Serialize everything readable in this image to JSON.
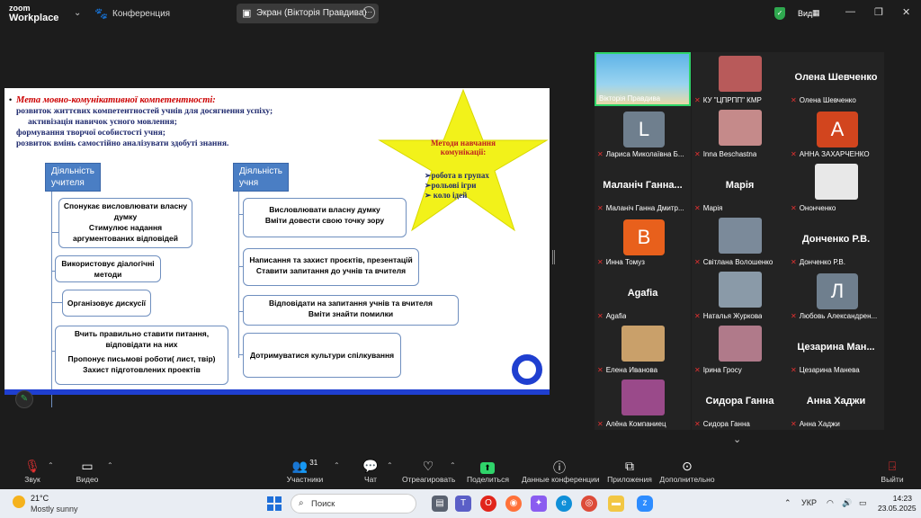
{
  "topbar": {
    "logo_line1": "zoom",
    "logo_line2": "Workplace",
    "conference_label": "Конференция",
    "share_label": "Экран (Вікторія Правдива)",
    "view_label": "Вид"
  },
  "slide": {
    "title": "Мета мовно-комунікативної компетентності:",
    "lines": [
      "розвиток життєвих компетентностей учнів для досягнення успіху;",
      "активізація навичок усного мовлення;",
      "формування творчої особистості учня;",
      "розвиток вмінь самостійно аналізувати здобуті знання."
    ],
    "star_title": "Методи навчання комунікації:",
    "star_items": [
      "➢робота в групах",
      "➢рольові ігри",
      "➢  коло ідей"
    ],
    "teacher_header": "Діяльність учителя",
    "student_header": "Діяльність учня",
    "teacher_boxes": [
      "Спонукає висловлювати власну думку",
      "Стимулює надання аргументованих відповідей",
      "Використовує діалогічні методи",
      "Організовує дискусії",
      "Вчить правильно ставити питання, відповідати на них",
      "Пропонує письмові роботи( лист, твір)  Захист підготовлених проектів"
    ],
    "student_boxes": [
      "Висловлювати власну думку",
      "Вміти довести свою точку зору",
      "Написання та захист проєктів, презентацій",
      "Ставити запитання до учнів та вчителя",
      "Відповідати на запитання учнів та вчителя",
      "Вміти знайти помилки",
      "Дотримуватися культури спілкування"
    ]
  },
  "gallery": [
    {
      "label": "Вікторія Правдива",
      "big": "",
      "letter": "",
      "kind": "photo",
      "active": true,
      "color": "#4aa3d8",
      "muted": false
    },
    {
      "label": "КУ \"ЦПРПП\" КМР",
      "big": "",
      "letter": "",
      "kind": "photo",
      "active": false,
      "color": "#b85a5a",
      "muted": true
    },
    {
      "label": "Олена Шевченко",
      "big": "Олена Шевченко",
      "letter": "",
      "kind": "name",
      "active": false,
      "color": "",
      "muted": true
    },
    {
      "label": "Лариса Миколаївна Б...",
      "big": "",
      "letter": "L",
      "kind": "letter",
      "active": false,
      "color": "#6f7f8e",
      "muted": true
    },
    {
      "label": "Inna Beschastna",
      "big": "",
      "letter": "",
      "kind": "photo",
      "active": false,
      "color": "#c58a8a",
      "muted": true
    },
    {
      "label": "АННА ЗАХАРЧЕНКО",
      "big": "",
      "letter": "A",
      "kind": "letter",
      "active": false,
      "color": "#d2451e",
      "muted": true
    },
    {
      "label": "Маланіч Ганна Дмитр...",
      "big": "Маланіч Ганна...",
      "letter": "",
      "kind": "name",
      "active": false,
      "color": "",
      "muted": true
    },
    {
      "label": "Марія",
      "big": "Марія",
      "letter": "",
      "kind": "name",
      "active": false,
      "color": "",
      "muted": true
    },
    {
      "label": "Ононченко",
      "big": "",
      "letter": "",
      "kind": "photo",
      "active": false,
      "color": "#e8e8e8",
      "muted": true
    },
    {
      "label": "Инна Томуз",
      "big": "",
      "letter": "B",
      "kind": "letter",
      "active": false,
      "color": "#e8601c",
      "muted": true
    },
    {
      "label": "Світлана Волошенко",
      "big": "",
      "letter": "",
      "kind": "photo",
      "active": false,
      "color": "#7b8a9a",
      "muted": true
    },
    {
      "label": "Донченко Р.В.",
      "big": "Донченко Р.В.",
      "letter": "",
      "kind": "name",
      "active": false,
      "color": "",
      "muted": true
    },
    {
      "label": "Agafia",
      "big": "Agafia",
      "letter": "",
      "kind": "name",
      "active": false,
      "color": "",
      "muted": true
    },
    {
      "label": "Наталья Журкова",
      "big": "",
      "letter": "",
      "kind": "photo",
      "active": false,
      "color": "#8a9aa8",
      "muted": true
    },
    {
      "label": "Любовь Александрен...",
      "big": "",
      "letter": "Л",
      "kind": "letter",
      "active": false,
      "color": "#6f7f8e",
      "muted": true
    },
    {
      "label": "Елена Иванова",
      "big": "",
      "letter": "",
      "kind": "photo",
      "active": false,
      "color": "#c9a06a",
      "muted": true
    },
    {
      "label": "Ірина  Гросу",
      "big": "",
      "letter": "",
      "kind": "photo",
      "active": false,
      "color": "#b07a8a",
      "muted": true
    },
    {
      "label": "Цезарина Манева",
      "big": "Цезарина Ман...",
      "letter": "",
      "kind": "name",
      "active": false,
      "color": "",
      "muted": true
    },
    {
      "label": "Алёна Компаниец",
      "big": "",
      "letter": "",
      "kind": "photo",
      "active": false,
      "color": "#9a4a8a",
      "muted": true
    },
    {
      "label": "Сидора Ганна",
      "big": "Сидора Ганна",
      "letter": "",
      "kind": "name",
      "active": false,
      "color": "",
      "muted": true
    },
    {
      "label": "Анна Хаджи",
      "big": "Анна Хаджи",
      "letter": "",
      "kind": "name",
      "active": false,
      "color": "",
      "muted": true
    }
  ],
  "toolbar": {
    "audio": "Звук",
    "video": "Видео",
    "participants": "Участники",
    "participants_count": "31",
    "chat": "Чат",
    "react": "Отреагировать",
    "share": "Поделиться",
    "info": "Данные конференции",
    "apps": "Приложения",
    "more": "Дополнительно",
    "leave": "Выйти"
  },
  "taskbar": {
    "temp": "21°C",
    "weather": "Mostly sunny",
    "search": "Поиск",
    "lang": "УКР",
    "time": "14:23",
    "date": "23.05.2025"
  },
  "colors": {
    "accent_green": "#2fd46a",
    "slide_blue": "#1f3fd0",
    "star_yellow": "#f2f21a",
    "header_blue": "#4a7ec4"
  }
}
